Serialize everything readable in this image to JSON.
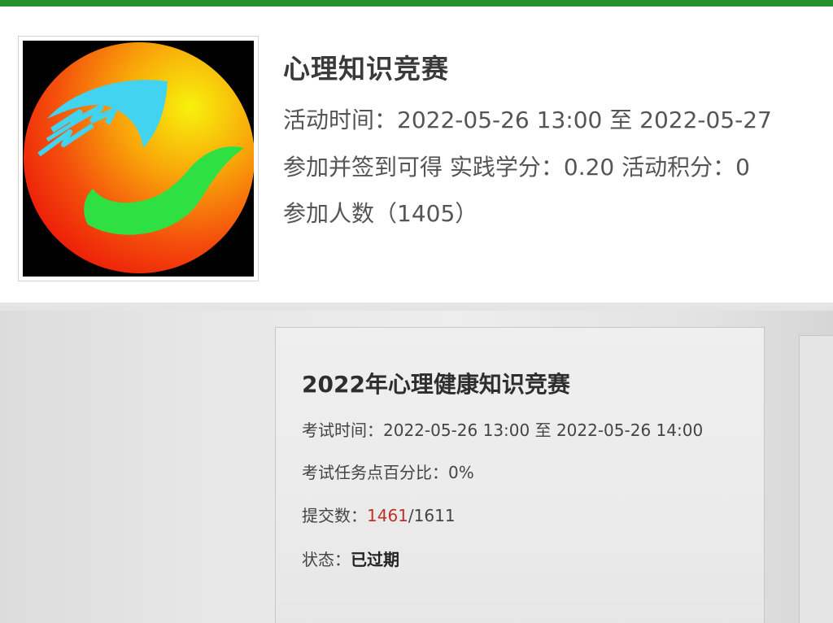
{
  "theme": {
    "accent": "#23912e",
    "highlight": "#c0302a"
  },
  "activity": {
    "title": "心理知识竞赛",
    "time_label": "活动时间：",
    "time_value": "2022-05-26 13:00 至 2022-05-27",
    "credit_text": "参加并签到可得 实践学分：0.20 活动积分：0",
    "count_label": "参加人数（",
    "count_value": "1405",
    "count_suffix": "）",
    "logo_icon": "activity-logo-icon"
  },
  "exam": {
    "title": "2022年心理健康知识竞赛",
    "time_label": "考试时间：",
    "time_value": "2022-05-26 13:00 至 2022-05-26 14:00",
    "ratio_label": "考试任务点百分比：",
    "ratio_value": "0%",
    "submit_label": "提交数：",
    "submit_count": "1461",
    "submit_sep": "/",
    "submit_total": "1611",
    "status_label": "状态：",
    "status_value": "已过期"
  }
}
